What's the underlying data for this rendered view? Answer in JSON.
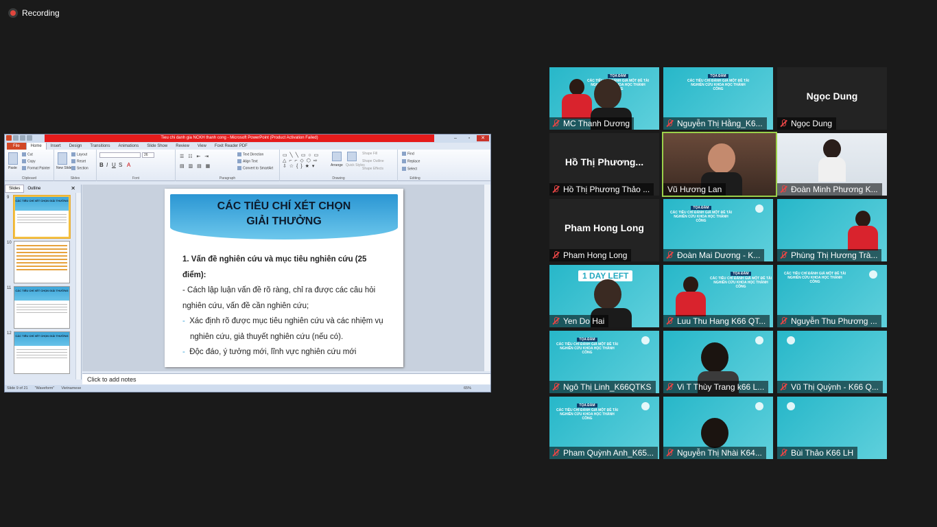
{
  "recording": {
    "label": "Recording"
  },
  "ppt": {
    "window_title": "Tieu chi danh gia NCKH thanh cong - Microsoft PowerPoint (Product Activation Failed)",
    "tabs": [
      "File",
      "Home",
      "Insert",
      "Design",
      "Transitions",
      "Animations",
      "Slide Show",
      "Review",
      "View",
      "Foxit Reader PDF"
    ],
    "ribbon": {
      "clipboard": {
        "label": "Clipboard",
        "paste": "Paste",
        "cut": "Cut",
        "copy": "Copy",
        "format_painter": "Format Painter"
      },
      "slides": {
        "label": "Slides",
        "new_slide": "New Slide",
        "layout": "Layout",
        "reset": "Reset",
        "section": "Section"
      },
      "font": {
        "label": "Font",
        "size": "26"
      },
      "paragraph": {
        "label": "Paragraph",
        "text_direction": "Text Direction",
        "align_text": "Align Text",
        "convert_smartart": "Convert to SmartArt"
      },
      "drawing": {
        "label": "Drawing",
        "arrange": "Arrange",
        "quick_styles": "Quick Styles",
        "shape_fill": "Shape Fill",
        "shape_outline": "Shape Outline",
        "shape_effects": "Shape Effects"
      },
      "editing": {
        "label": "Editing",
        "find": "Find",
        "replace": "Replace",
        "select": "Select"
      }
    },
    "left_pane": {
      "tab_slides": "Slides",
      "tab_outline": "Outline",
      "thumbs": [
        {
          "num": "9",
          "title": "CÁC TIÊU CHÍ XÉT CHỌN GIẢI THƯỞNG"
        },
        {
          "num": "10",
          "title": ""
        },
        {
          "num": "11",
          "title": "CÁC TIÊU CHÍ XÉT CHỌN GIẢI THƯỞNG"
        },
        {
          "num": "12",
          "title": "CÁC TIÊU CHÍ XÉT CHỌN GIẢI THƯỞNG"
        }
      ]
    },
    "slide": {
      "title_line1": "CÁC TIÊU CHÍ XÉT CHỌN",
      "title_line2": "GIẢI THƯỞNG",
      "heading": "1. Vấn đề nghiên cứu và mục tiêu nghiên cứu (25 điểm):",
      "line1": "- Cách lập luận vấn đề rõ ràng, chỉ ra được các câu hỏi",
      "line2": "nghiên cứu, vấn đề cần nghiên cứu;",
      "line3_dash": "-",
      "line3": "Xác định rõ được mục tiêu nghiên cứu và các nhiệm vụ",
      "line4": "nghiên cứu, giả thuyết nghiên cứu (nếu có).",
      "line5_dash": "-",
      "line5": "Độc đáo, ý tưởng mới, lĩnh vực nghiên cứu mới"
    },
    "notes_placeholder": "Click to add notes",
    "status": {
      "slide": "Slide 9 of 21",
      "theme": "\"Waveform\"",
      "language": "Vietnamese",
      "zoom": "65%"
    }
  },
  "participants": [
    {
      "name": "MC Thanh Dương",
      "type": "promo-person"
    },
    {
      "name": "Nguyễn Thị Hằng_K6...",
      "type": "promo"
    },
    {
      "name": "Ngọc Dung",
      "type": "dark",
      "center": "Ngọc Dung"
    },
    {
      "name": "Hồ Thị Phương Thảo ...",
      "type": "dark",
      "center": "Hồ Thị Phương..."
    },
    {
      "name": "Vũ Hương Lan",
      "type": "room",
      "active": true
    },
    {
      "name": "Đoàn Minh Phương K...",
      "type": "white"
    },
    {
      "name": "Pham Hong Long",
      "type": "dark",
      "center": "Pham Hong Long"
    },
    {
      "name": "Đoàn Mai Dương - K...",
      "type": "promo"
    },
    {
      "name": "Phùng Thị Hương Trà...",
      "type": "promo-person"
    },
    {
      "name": "Yen Do Hai",
      "type": "promo-person",
      "badge": "1 DAY LEFT"
    },
    {
      "name": "Luu Thu Hang K66 QT...",
      "type": "promo-person"
    },
    {
      "name": "Nguyễn Thu Phương ...",
      "type": "promo"
    },
    {
      "name": "Ngô Thị Linh_K66QTKS",
      "type": "promo"
    },
    {
      "name": "Vi T Thùy Trang k66 L...",
      "type": "promo-face"
    },
    {
      "name": "Vũ Thị Quỳnh - K66 Q...",
      "type": "promo"
    },
    {
      "name": "Pham Quỳnh Anh_K65...",
      "type": "promo"
    },
    {
      "name": "Nguyễn Thị Nhài K64...",
      "type": "promo-face"
    },
    {
      "name": "Bùi Thảo K66 LH",
      "type": "promo"
    }
  ],
  "promo_text": {
    "line1": "TỌA ĐÀM",
    "line2": "CÁC TIÊU CHÍ ĐÁNH GIÁ MỘT ĐỀ TÀI NGHIÊN CỨU KHOA HỌC THÀNH CÔNG"
  },
  "colors": {
    "accent_red": "#e61c1c",
    "active_border": "#9bd14a",
    "promo_teal": "#27b7c9",
    "mic_muted": "#e84545"
  }
}
